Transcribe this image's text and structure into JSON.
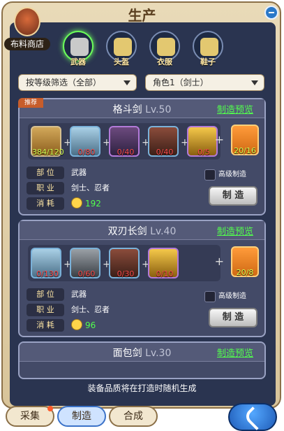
{
  "header": {
    "title": "生产",
    "shop_label": "布料商店"
  },
  "categories": [
    {
      "label": "武器",
      "active": true
    },
    {
      "label": "头盔",
      "active": false
    },
    {
      "label": "衣服",
      "active": false
    },
    {
      "label": "鞋子",
      "active": false
    }
  ],
  "filters": {
    "level_filter": "按等级筛选（全部）",
    "role_filter": "角色1（剑士）"
  },
  "recipes": [
    {
      "tag": "推荐",
      "name": "格斗剑",
      "level": "Lv.50",
      "preview": "制造预览",
      "materials": [
        "384/120",
        "0/80",
        "0/40",
        "0/40",
        "0/5"
      ],
      "result": "20/16",
      "slot_label": "部 位",
      "slot_value": "武器",
      "class_label": "职 业",
      "class_value": "剑士、忍者",
      "cost_label": "消 耗",
      "cost_value": "192",
      "advanced": "高级制造",
      "make": "制 造"
    },
    {
      "tag": "",
      "name": "双刃长剑",
      "level": "Lv.40",
      "preview": "制造预览",
      "materials": [
        "0/130",
        "0/60",
        "0/30",
        "0/10"
      ],
      "result": "20/8",
      "slot_label": "部 位",
      "slot_value": "武器",
      "class_label": "职 业",
      "class_value": "剑士、忍者",
      "cost_label": "消 耗",
      "cost_value": "96",
      "advanced": "高级制造",
      "make": "制 造"
    },
    {
      "name": "面包剑",
      "level": "Lv.30",
      "preview": "制造预览"
    }
  ],
  "note": "装备品质将在打造时随机生成",
  "bottom_tabs": [
    "采集",
    "制造",
    "合成"
  ],
  "colors": {
    "accent_green": "#52ff4d",
    "panel": "#2a3450"
  }
}
